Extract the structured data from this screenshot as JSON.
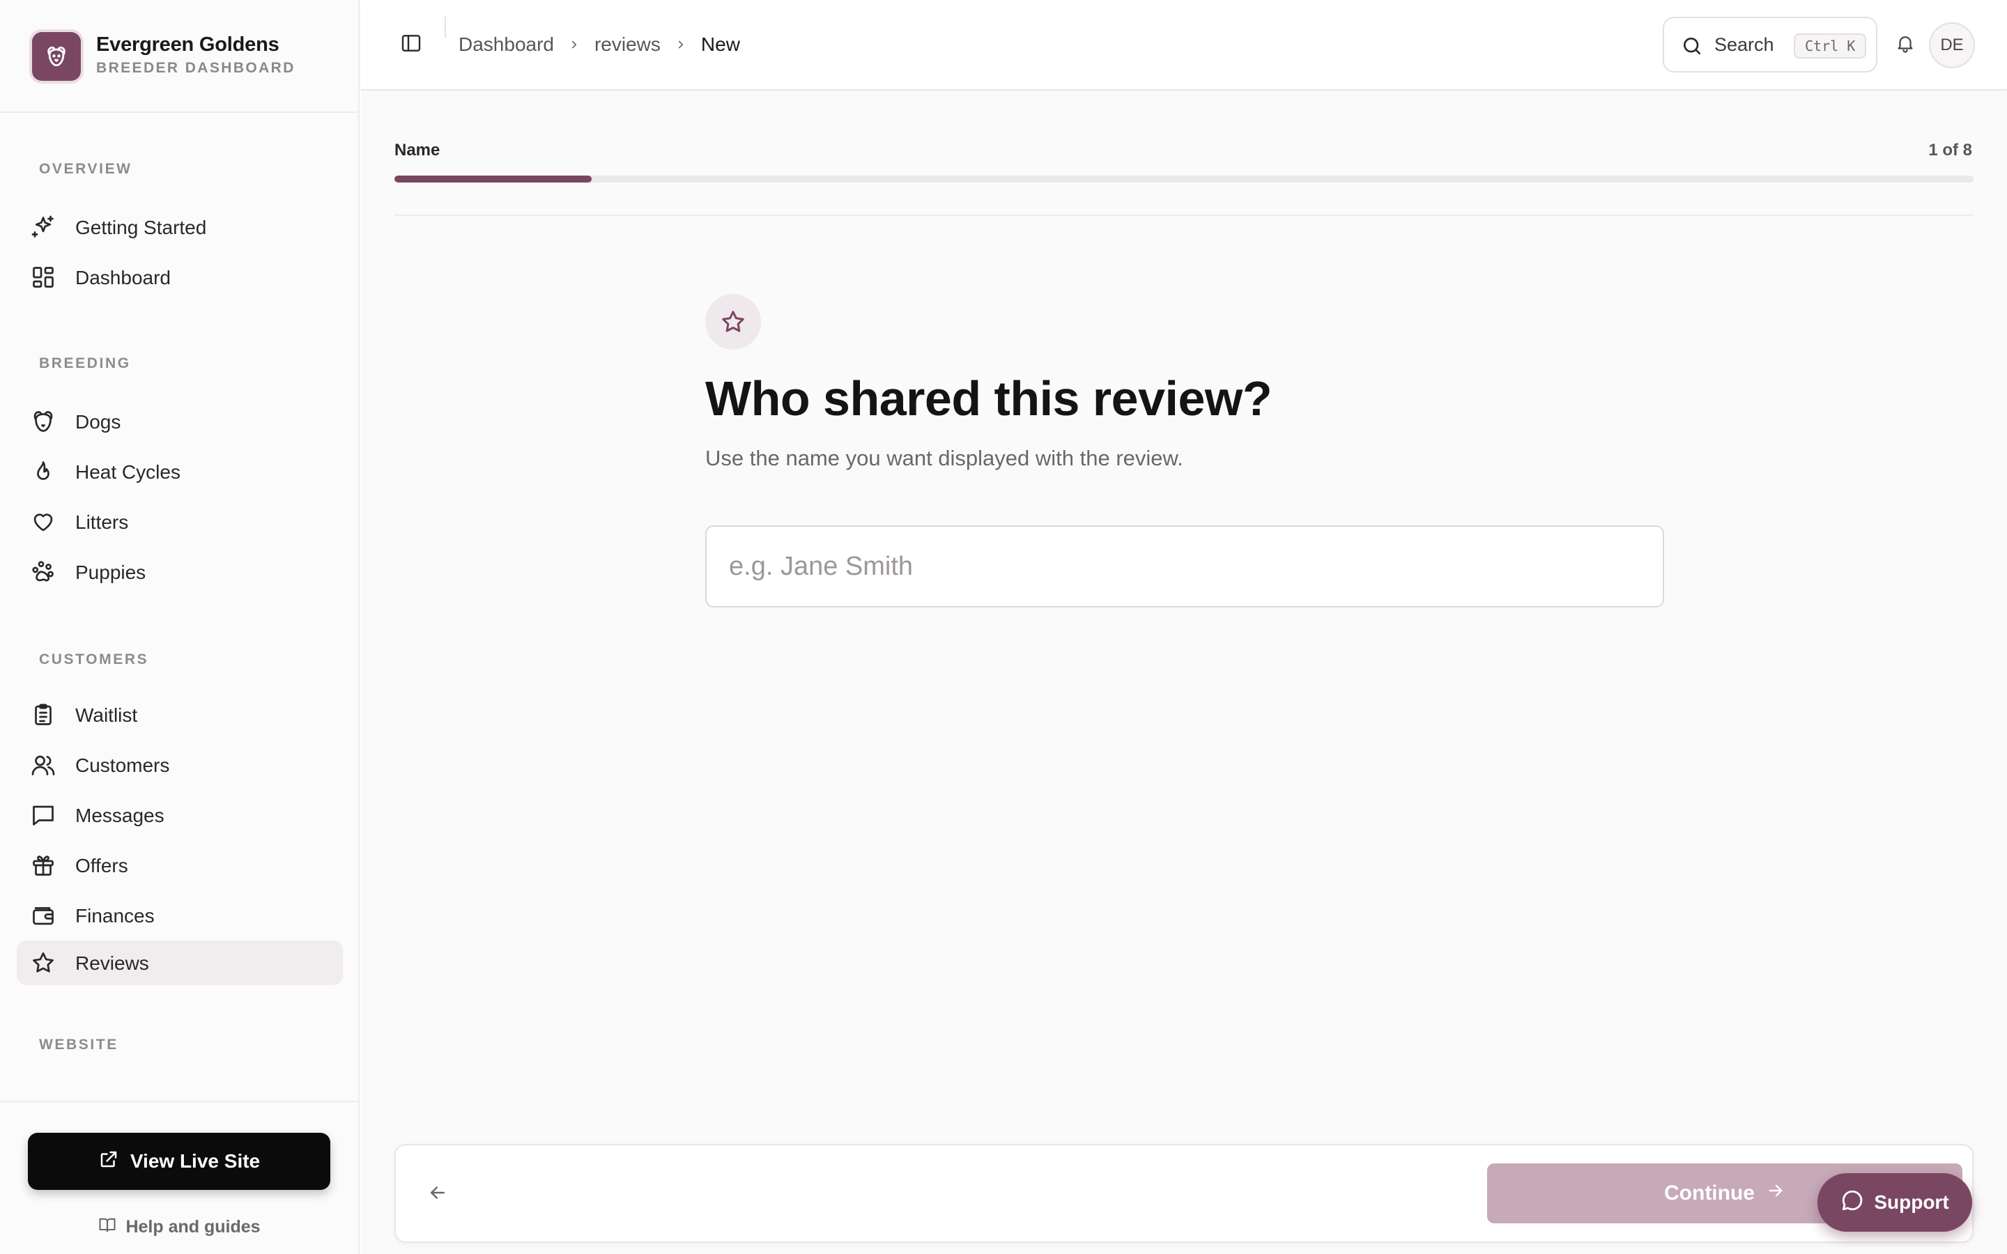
{
  "brand": {
    "name": "Evergreen Goldens",
    "subtitle": "BREEDER DASHBOARD",
    "accent_color": "#7a4762"
  },
  "sidebar": {
    "sections": [
      {
        "title": "OVERVIEW",
        "items": [
          {
            "label": "Getting Started",
            "icon": "sparkles-icon"
          },
          {
            "label": "Dashboard",
            "icon": "grid-icon"
          }
        ]
      },
      {
        "title": "BREEDING",
        "items": [
          {
            "label": "Dogs",
            "icon": "dog-icon"
          },
          {
            "label": "Heat Cycles",
            "icon": "flame-icon"
          },
          {
            "label": "Litters",
            "icon": "heart-icon"
          },
          {
            "label": "Puppies",
            "icon": "paw-icon"
          }
        ]
      },
      {
        "title": "CUSTOMERS",
        "items": [
          {
            "label": "Waitlist",
            "icon": "clipboard-icon"
          },
          {
            "label": "Customers",
            "icon": "users-icon"
          },
          {
            "label": "Messages",
            "icon": "message-icon"
          },
          {
            "label": "Offers",
            "icon": "gift-icon"
          },
          {
            "label": "Finances",
            "icon": "wallet-icon"
          },
          {
            "label": "Reviews",
            "icon": "star-icon",
            "active": true
          }
        ]
      },
      {
        "title": "WEBSITE",
        "items": []
      }
    ],
    "view_live_site": "View Live Site",
    "help": "Help and guides"
  },
  "topbar": {
    "breadcrumb": [
      "Dashboard",
      "reviews",
      "New"
    ],
    "search_label": "Search",
    "search_shortcut": "Ctrl K",
    "avatar_initials": "DE"
  },
  "wizard": {
    "step_label": "Name",
    "step_count": "1 of 8",
    "progress": 0.125,
    "question": "Who shared this review?",
    "hint": "Use the name you want displayed with the review.",
    "input_placeholder": "e.g. Jane Smith",
    "input_value": "",
    "continue_label": "Continue"
  },
  "support_label": "Support"
}
